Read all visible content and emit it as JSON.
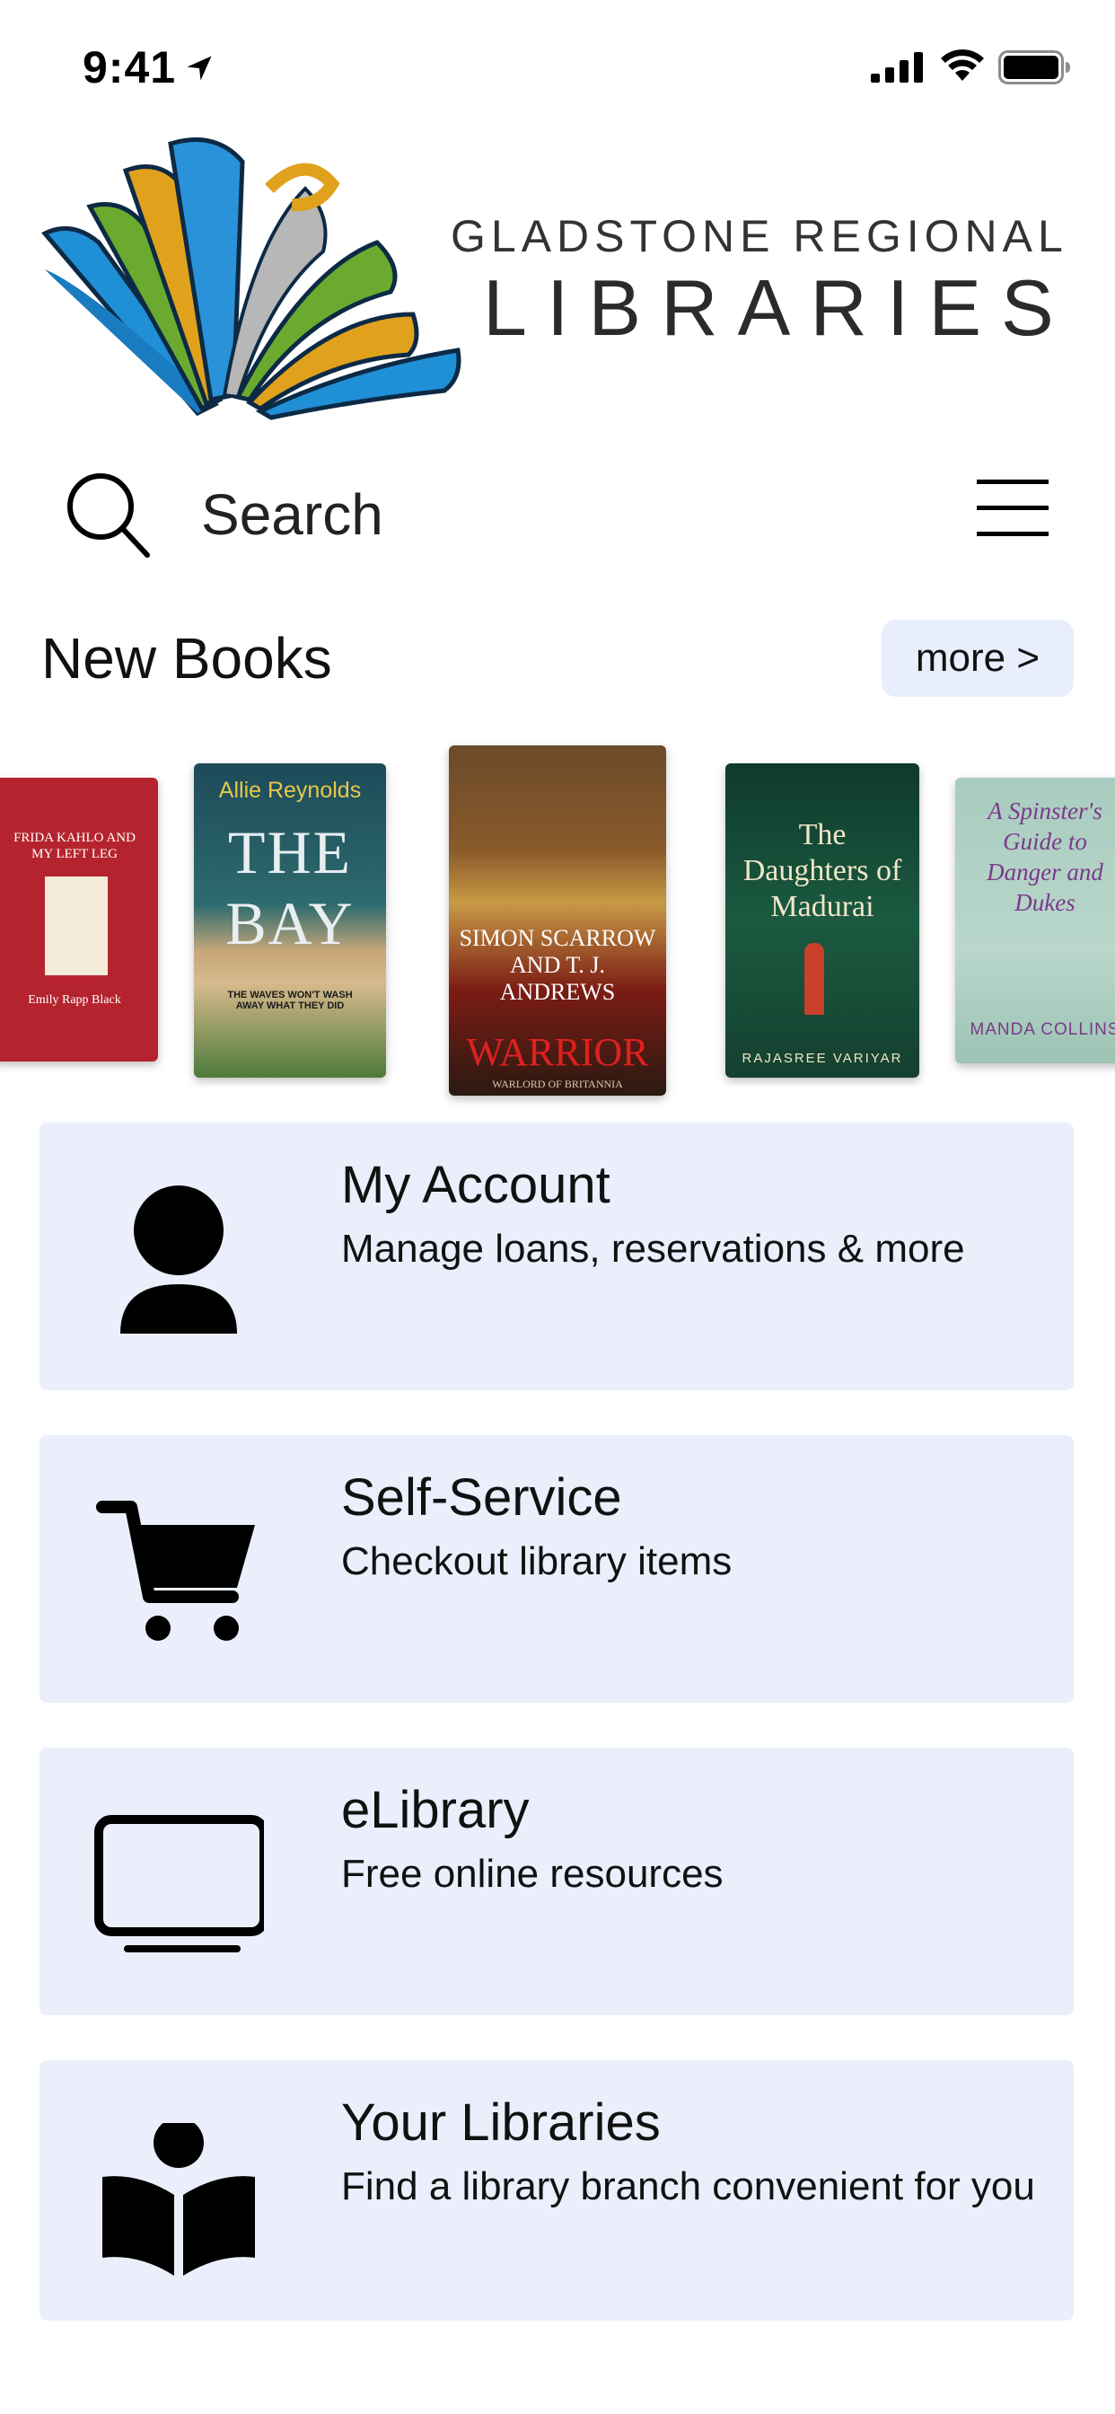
{
  "status_bar": {
    "time": "9:41"
  },
  "logo": {
    "line1": "GLADSTONE REGIONAL",
    "line2": "LIBRARIES"
  },
  "search": {
    "label": "Search"
  },
  "new_books": {
    "title": "New Books",
    "more_label": "more >",
    "books": [
      {
        "title_text": "FRIDA KAHLO AND MY LEFT LEG",
        "author_text": "Emily Rapp Black"
      },
      {
        "author_text": "Allie Reynolds",
        "title_text": "THE BAY",
        "tagline": "THE WAVES WON'T WASH AWAY WHAT THEY DID"
      },
      {
        "author_text": "SIMON SCARROW AND T. J. ANDREWS",
        "title_text": "WARRIOR",
        "series": "WARLORD OF BRITANNIA"
      },
      {
        "title_text": "The Daughters of Madurai",
        "author_text": "RAJASREE VARIYAR"
      },
      {
        "title_text": "A Spinster's Guide to Danger and Dukes",
        "author_text": "MANDA COLLINS"
      }
    ]
  },
  "menu": [
    {
      "title": "My Account",
      "subtitle": "Manage loans, reservations & more",
      "icon": "person-icon"
    },
    {
      "title": "Self-Service",
      "subtitle": "Checkout library items",
      "icon": "cart-icon"
    },
    {
      "title": "eLibrary",
      "subtitle": "Free online resources",
      "icon": "monitor-icon"
    },
    {
      "title": "Your Libraries",
      "subtitle": "Find a library branch convenient for you",
      "icon": "reader-icon"
    }
  ],
  "colors": {
    "card_bg": "#eaeffb",
    "more_bg": "#e9eefc"
  }
}
